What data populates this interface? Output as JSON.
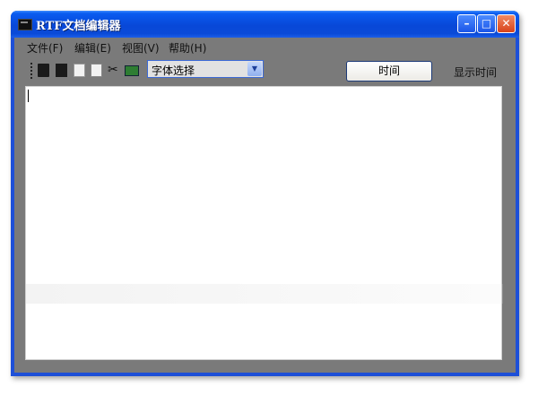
{
  "window": {
    "title": "RTF文档编辑器",
    "controls": {
      "minimize": "–",
      "maximize": "□",
      "close": "✕"
    }
  },
  "menu": {
    "items": [
      "文件(F)",
      "编辑(E)",
      "视图(V)",
      "帮助(H)"
    ]
  },
  "toolbar": {
    "font_select": {
      "selected": "字体选择"
    },
    "time_button_label": "时间",
    "time_display": "显示时间"
  },
  "editor": {
    "content": ""
  },
  "icons": {
    "app": "app-window-icon",
    "tools": [
      "new-document-icon",
      "open-document-icon",
      "save-icon",
      "copy-icon",
      "cut-icon",
      "paste-icon"
    ],
    "dropdown": "chevron-down-icon"
  },
  "colors": {
    "titlebar": "#0848d8",
    "window_bg": "#7a7a7a",
    "close_button": "#d8431a"
  }
}
